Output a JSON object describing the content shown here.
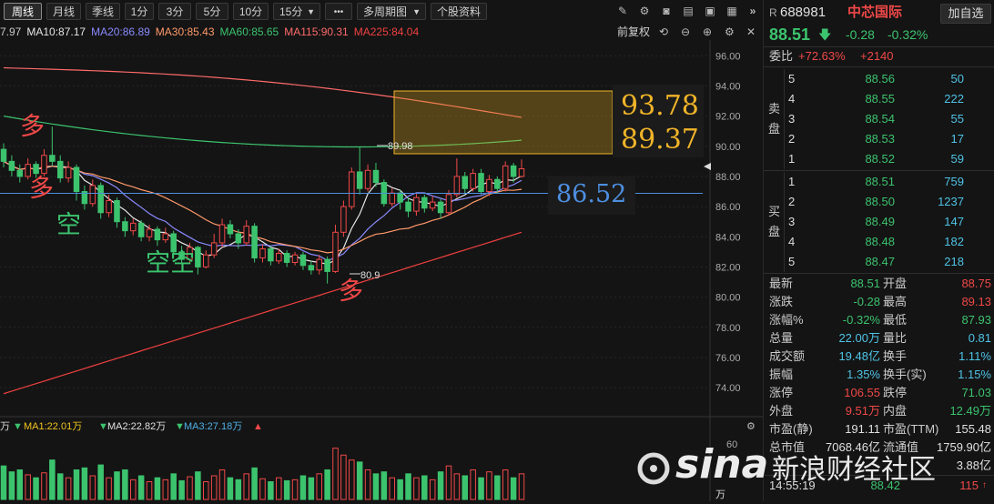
{
  "toolbar": {
    "periods": [
      "周线",
      "月线",
      "季线",
      "1分",
      "3分",
      "5分",
      "10分",
      "15分"
    ],
    "active_period": "周线",
    "more": "•••",
    "multi_period": "多周期图",
    "stock_info": "个股资料"
  },
  "ma_bar": {
    "first": "7.97",
    "ma10": "MA10:87.17",
    "ma20": "MA20:86.89",
    "ma30": "MA30:85.43",
    "ma60": "MA60:85.65",
    "ma115": "MA115:90.31",
    "ma225": "MA225:84.04",
    "fuquan": "前复权"
  },
  "colors": {
    "up": "#f04848",
    "down": "#3cc36e",
    "ma10": "#e6e6e6",
    "ma20": "#8a8aff",
    "ma30": "#ff9a6a",
    "ma60": "#3cc36e",
    "ma115": "#ff6a6a",
    "ma225": "#f04040",
    "target": "#f0b429",
    "bg": "#141414"
  },
  "chart": {
    "y_ticks": [
      "96.00",
      "94.00",
      "92.00",
      "90.00",
      "88.00",
      "86.00",
      "84.00",
      "82.00",
      "80.00",
      "78.00",
      "76.00",
      "74.00"
    ],
    "target_high": "93.78",
    "target_low": "89.37",
    "current_line_label": "86.52",
    "high_mark": "89.98",
    "low_mark": "80.9",
    "annotations": [
      "多",
      "多",
      "空",
      "空空",
      "多"
    ],
    "vol_bar": {
      "prefix": "万",
      "ma1": "MA1:22.01万",
      "ma2": "MA2:22.82万",
      "ma3": "MA3:27.18万"
    },
    "vol_ticks": [
      "60",
      "万"
    ]
  },
  "chart_data": {
    "type": "candlestick",
    "ylim": [
      72.5,
      96.8
    ],
    "candles": [
      {
        "o": 89.8,
        "c": 89.0,
        "h": 90.2,
        "l": 88.6
      },
      {
        "o": 89.0,
        "c": 88.4,
        "h": 89.4,
        "l": 88.0
      },
      {
        "o": 88.4,
        "c": 88.0,
        "h": 88.8,
        "l": 87.6
      },
      {
        "o": 88.0,
        "c": 88.8,
        "h": 89.2,
        "l": 87.8
      },
      {
        "o": 88.8,
        "c": 88.2,
        "h": 89.0,
        "l": 87.9
      },
      {
        "o": 88.2,
        "c": 89.4,
        "h": 89.8,
        "l": 88.0
      },
      {
        "o": 89.4,
        "c": 89.0,
        "h": 91.3,
        "l": 88.7
      },
      {
        "o": 89.0,
        "c": 87.9,
        "h": 89.4,
        "l": 87.6
      },
      {
        "o": 87.9,
        "c": 88.6,
        "h": 89.0,
        "l": 87.6
      },
      {
        "o": 88.6,
        "c": 87.0,
        "h": 88.8,
        "l": 86.4
      },
      {
        "o": 87.0,
        "c": 86.2,
        "h": 87.4,
        "l": 85.8
      },
      {
        "o": 86.2,
        "c": 87.4,
        "h": 87.8,
        "l": 86.0
      },
      {
        "o": 87.4,
        "c": 85.6,
        "h": 87.6,
        "l": 85.2
      },
      {
        "o": 85.6,
        "c": 86.4,
        "h": 86.8,
        "l": 85.3
      },
      {
        "o": 86.4,
        "c": 85.0,
        "h": 86.6,
        "l": 84.6
      },
      {
        "o": 85.0,
        "c": 84.4,
        "h": 85.3,
        "l": 84.0
      },
      {
        "o": 84.4,
        "c": 84.9,
        "h": 85.2,
        "l": 84.1
      },
      {
        "o": 84.9,
        "c": 84.0,
        "h": 85.1,
        "l": 83.7
      },
      {
        "o": 84.0,
        "c": 84.5,
        "h": 84.8,
        "l": 83.7
      },
      {
        "o": 84.5,
        "c": 83.8,
        "h": 84.7,
        "l": 83.4
      },
      {
        "o": 83.8,
        "c": 84.2,
        "h": 84.6,
        "l": 83.6
      },
      {
        "o": 84.2,
        "c": 83.0,
        "h": 84.4,
        "l": 82.8
      },
      {
        "o": 83.0,
        "c": 82.5,
        "h": 83.4,
        "l": 82.2
      },
      {
        "o": 82.5,
        "c": 83.3,
        "h": 83.6,
        "l": 82.3
      },
      {
        "o": 83.3,
        "c": 82.0,
        "h": 83.4,
        "l": 81.5
      },
      {
        "o": 82.0,
        "c": 82.8,
        "h": 83.1,
        "l": 81.9
      },
      {
        "o": 82.8,
        "c": 83.6,
        "h": 84.2,
        "l": 82.6
      },
      {
        "o": 83.6,
        "c": 84.8,
        "h": 85.2,
        "l": 83.3
      },
      {
        "o": 84.8,
        "c": 84.2,
        "h": 85.1,
        "l": 83.9
      },
      {
        "o": 84.2,
        "c": 83.6,
        "h": 84.5,
        "l": 83.2
      },
      {
        "o": 83.6,
        "c": 84.7,
        "h": 85.1,
        "l": 83.4
      },
      {
        "o": 84.7,
        "c": 82.6,
        "h": 84.9,
        "l": 82.3
      },
      {
        "o": 82.6,
        "c": 83.2,
        "h": 83.5,
        "l": 82.3
      },
      {
        "o": 83.2,
        "c": 82.4,
        "h": 83.4,
        "l": 82.1
      },
      {
        "o": 82.4,
        "c": 82.9,
        "h": 83.2,
        "l": 82.2
      },
      {
        "o": 82.9,
        "c": 82.3,
        "h": 83.1,
        "l": 82.0
      },
      {
        "o": 82.3,
        "c": 82.8,
        "h": 83.0,
        "l": 82.1
      },
      {
        "o": 82.8,
        "c": 82.1,
        "h": 83.0,
        "l": 81.8
      },
      {
        "o": 82.1,
        "c": 81.8,
        "h": 82.4,
        "l": 81.5
      },
      {
        "o": 81.8,
        "c": 82.5,
        "h": 82.8,
        "l": 81.5
      },
      {
        "o": 82.5,
        "c": 81.7,
        "h": 82.7,
        "l": 80.9
      },
      {
        "o": 81.7,
        "c": 84.3,
        "h": 84.8,
        "l": 81.6
      },
      {
        "o": 84.3,
        "c": 86.0,
        "h": 86.4,
        "l": 84.0
      },
      {
        "o": 86.0,
        "c": 88.3,
        "h": 88.6,
        "l": 85.8
      },
      {
        "o": 88.3,
        "c": 87.2,
        "h": 89.98,
        "l": 86.8
      },
      {
        "o": 87.2,
        "c": 88.4,
        "h": 88.8,
        "l": 87.0
      },
      {
        "o": 88.4,
        "c": 87.6,
        "h": 88.9,
        "l": 87.3
      },
      {
        "o": 87.6,
        "c": 86.2,
        "h": 87.8,
        "l": 86.0
      },
      {
        "o": 86.2,
        "c": 86.9,
        "h": 87.2,
        "l": 86.0
      },
      {
        "o": 86.9,
        "c": 86.3,
        "h": 87.1,
        "l": 85.8
      },
      {
        "o": 86.3,
        "c": 85.7,
        "h": 86.6,
        "l": 85.3
      },
      {
        "o": 85.7,
        "c": 86.6,
        "h": 86.9,
        "l": 85.4
      },
      {
        "o": 86.6,
        "c": 85.9,
        "h": 86.8,
        "l": 85.6
      },
      {
        "o": 85.9,
        "c": 86.3,
        "h": 86.7,
        "l": 85.7
      },
      {
        "o": 86.3,
        "c": 85.6,
        "h": 86.5,
        "l": 85.2
      },
      {
        "o": 85.6,
        "c": 86.8,
        "h": 87.1,
        "l": 85.4
      },
      {
        "o": 86.8,
        "c": 88.0,
        "h": 89.2,
        "l": 86.6
      },
      {
        "o": 88.0,
        "c": 87.2,
        "h": 88.3,
        "l": 86.9
      },
      {
        "o": 87.2,
        "c": 88.2,
        "h": 88.5,
        "l": 87.0
      },
      {
        "o": 88.2,
        "c": 87.0,
        "h": 88.5,
        "l": 86.8
      },
      {
        "o": 87.0,
        "c": 87.8,
        "h": 88.1,
        "l": 86.7
      },
      {
        "o": 87.8,
        "c": 87.2,
        "h": 88.0,
        "l": 86.9
      },
      {
        "o": 87.2,
        "c": 88.7,
        "h": 89.0,
        "l": 87.0
      },
      {
        "o": 88.7,
        "c": 88.0,
        "h": 88.9,
        "l": 87.6
      },
      {
        "o": 88.0,
        "c": 88.51,
        "h": 89.13,
        "l": 87.93
      }
    ],
    "volume": [
      34,
      28,
      30,
      25,
      22,
      27,
      40,
      26,
      22,
      30,
      32,
      24,
      35,
      22,
      28,
      30,
      20,
      24,
      18,
      22,
      20,
      26,
      19,
      23,
      28,
      18,
      24,
      30,
      22,
      20,
      26,
      32,
      21,
      18,
      22,
      19,
      20,
      24,
      22,
      26,
      30,
      52,
      45,
      40,
      38,
      30,
      26,
      28,
      22,
      20,
      26,
      22,
      24,
      20,
      28,
      34,
      26,
      24,
      30,
      22,
      28,
      24,
      30,
      22,
      26
    ]
  },
  "right_panel": {
    "code_prefix": "R",
    "code": "688981",
    "name": "中芯国际",
    "add_btn": "加自选",
    "price": "88.51",
    "change": "-0.28",
    "change_pct": "-0.32%",
    "weibi_label": "委比",
    "weibi_pct": "+72.63%",
    "weibi_diff": "+2140",
    "sell_label": [
      "卖",
      "盘"
    ],
    "buy_label": [
      "买",
      "盘"
    ],
    "sells": [
      {
        "lvl": "5",
        "price": "88.56",
        "vol": "50"
      },
      {
        "lvl": "4",
        "price": "88.55",
        "vol": "222"
      },
      {
        "lvl": "3",
        "price": "88.54",
        "vol": "55"
      },
      {
        "lvl": "2",
        "price": "88.53",
        "vol": "17"
      },
      {
        "lvl": "1",
        "price": "88.52",
        "vol": "59"
      }
    ],
    "buys": [
      {
        "lvl": "1",
        "price": "88.51",
        "vol": "759"
      },
      {
        "lvl": "2",
        "price": "88.50",
        "vol": "1237"
      },
      {
        "lvl": "3",
        "price": "88.49",
        "vol": "147"
      },
      {
        "lvl": "4",
        "price": "88.48",
        "vol": "182"
      },
      {
        "lvl": "5",
        "price": "88.47",
        "vol": "218"
      }
    ],
    "stats": [
      {
        "l1": "最新",
        "v1": "88.51",
        "c1": "green",
        "l2": "开盘",
        "v2": "88.75",
        "c2": "red"
      },
      {
        "l1": "涨跌",
        "v1": "-0.28",
        "c1": "green",
        "l2": "最高",
        "v2": "89.13",
        "c2": "red"
      },
      {
        "l1": "涨幅%",
        "v1": "-0.32%",
        "c1": "green",
        "l2": "最低",
        "v2": "87.93",
        "c2": "green"
      },
      {
        "l1": "总量",
        "v1": "22.00万",
        "c1": "cyan",
        "l2": "量比",
        "v2": "0.81",
        "c2": "cyan"
      },
      {
        "l1": "成交额",
        "v1": "19.48亿",
        "c1": "cyan",
        "l2": "换手",
        "v2": "1.11%",
        "c2": "cyan"
      },
      {
        "l1": "振幅",
        "v1": "1.35%",
        "c1": "cyan",
        "l2": "换手(实)",
        "v2": "1.15%",
        "c2": "cyan"
      },
      {
        "l1": "涨停",
        "v1": "106.55",
        "c1": "red",
        "l2": "跌停",
        "v2": "71.03",
        "c2": "green"
      },
      {
        "l1": "外盘",
        "v1": "9.51万",
        "c1": "red",
        "l2": "内盘",
        "v2": "12.49万",
        "c2": "green"
      },
      {
        "l1": "市盈(静)",
        "v1": "191.11",
        "c1": "white",
        "l2": "市盈(TTM)",
        "v2": "155.48",
        "c2": "white"
      },
      {
        "l1": "总市值",
        "v1": "7068.46亿",
        "c1": "white",
        "l2": "流通值",
        "v2": "1759.90亿",
        "c2": "white"
      }
    ],
    "tick": {
      "time": "14:55:19",
      "price": "88.42",
      "vol": "115"
    },
    "partial_val": "3.88亿"
  },
  "watermark": {
    "brand": "sina",
    "text": "新浪财经社区"
  }
}
